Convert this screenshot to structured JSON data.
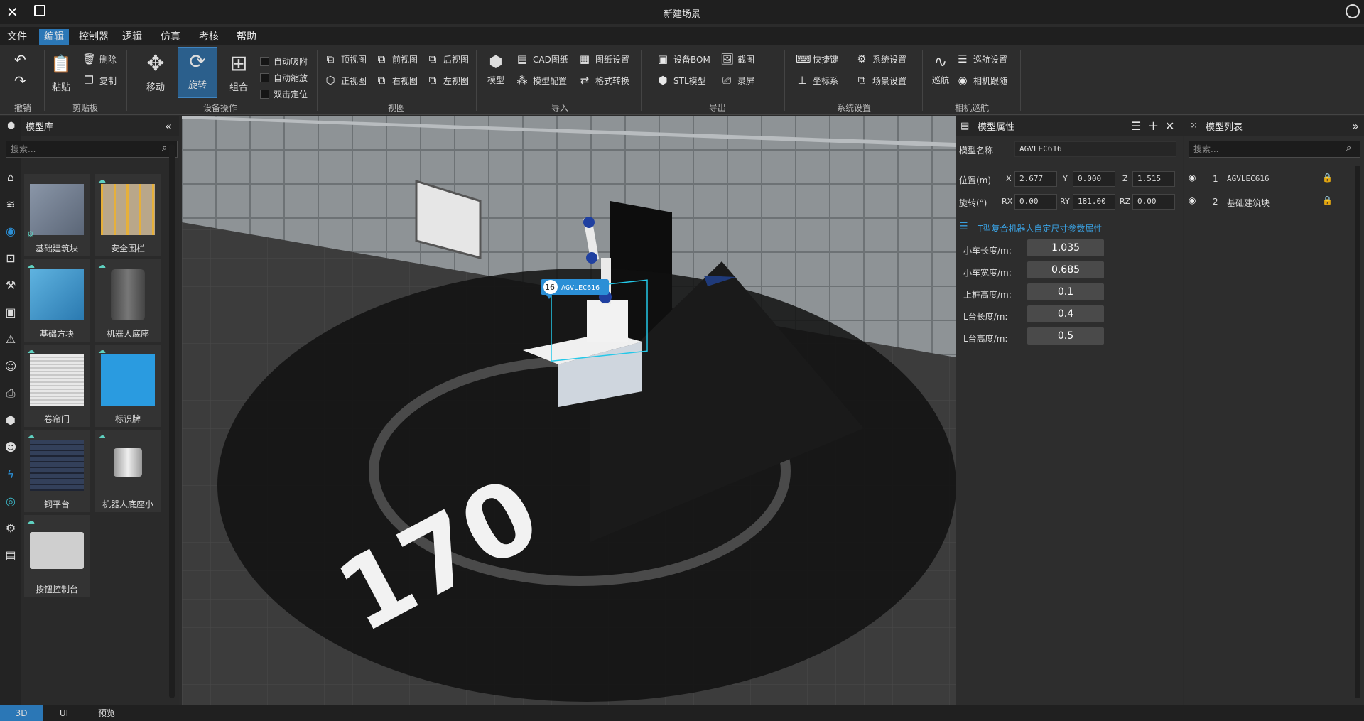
{
  "window": {
    "title": "新建场景"
  },
  "menu": [
    "文件",
    "编辑",
    "控制器",
    "逻辑",
    "仿真",
    "考核",
    "帮助"
  ],
  "ribbon": {
    "undo_group": {
      "label": "撤销"
    },
    "clipboard": {
      "label": "剪贴板",
      "paste": "粘贴",
      "delete": "删除",
      "copy": "复制"
    },
    "device_ops": {
      "label": "设备操作",
      "move": "移动",
      "rotate": "旋转",
      "group": "组合",
      "auto_snap": "自动吸附",
      "auto_zoom": "自动缩放",
      "dbl_locate": "双击定位"
    },
    "view": {
      "label": "视图",
      "top": "顶视图",
      "front": "前视图",
      "back": "后视图",
      "iso": "正视图",
      "right": "右视图",
      "left": "左视图"
    },
    "import": {
      "label": "导入",
      "model": "模型",
      "cad": "CAD图纸",
      "drawing_settings": "图纸设置",
      "model_config": "模型配置",
      "format_convert": "格式转换"
    },
    "export": {
      "label": "导出",
      "bom": "设备BOM",
      "stl": "STL模型",
      "screenshot": "截图",
      "record": "录屏"
    },
    "system": {
      "label": "系统设置",
      "shortcut": "快捷键",
      "sys_settings": "系统设置",
      "coord": "坐标系",
      "scene_settings": "场景设置"
    },
    "camera": {
      "label": "相机巡航",
      "patrol": "巡航",
      "patrol_settings": "巡航设置",
      "camera_follow": "相机跟随"
    }
  },
  "model_library": {
    "title": "模型库",
    "search_placeholder": "搜索...",
    "items": [
      {
        "label": "基础建筑块"
      },
      {
        "label": "安全围栏"
      },
      {
        "label": "基础方块"
      },
      {
        "label": "机器人底座"
      },
      {
        "label": "卷帘门"
      },
      {
        "label": "标识牌"
      },
      {
        "label": "钢平台"
      },
      {
        "label": "机器人底座小"
      },
      {
        "label": "按钮控制台"
      }
    ]
  },
  "viewport": {
    "angle_label": "170",
    "model_tag_number": "16",
    "model_tag_name": "AGVLEC616"
  },
  "properties": {
    "title": "模型属性",
    "name_label": "模型名称",
    "name_value": "AGVLEC616",
    "position_label": "位置(m)",
    "rotation_label": "旋转(°)",
    "x": "2.677",
    "y": "0.000",
    "z": "1.515",
    "rx": "0.00",
    "ry": "181.00",
    "rz": "0.00",
    "custom_section": "T型复合机器人自定尺寸参数属性",
    "params": [
      {
        "label": "小车长度/m:",
        "value": "1.035"
      },
      {
        "label": "小车宽度/m:",
        "value": "0.685"
      },
      {
        "label": "上桩高度/m:",
        "value": "0.1"
      },
      {
        "label": "L台长度/m:",
        "value": "0.4"
      },
      {
        "label": "L台高度/m:",
        "value": "0.5"
      }
    ]
  },
  "model_list": {
    "title": "模型列表",
    "search_placeholder": "搜索...",
    "items": [
      {
        "index": "1",
        "name": "AGVLEC616"
      },
      {
        "index": "2",
        "name": "基础建筑块"
      }
    ]
  },
  "status_tabs": [
    "3D",
    "UI",
    "预览"
  ],
  "colors": {
    "accent": "#2b77b6",
    "cloud": "#5fd0c0",
    "tag": "#2b8fd6"
  }
}
